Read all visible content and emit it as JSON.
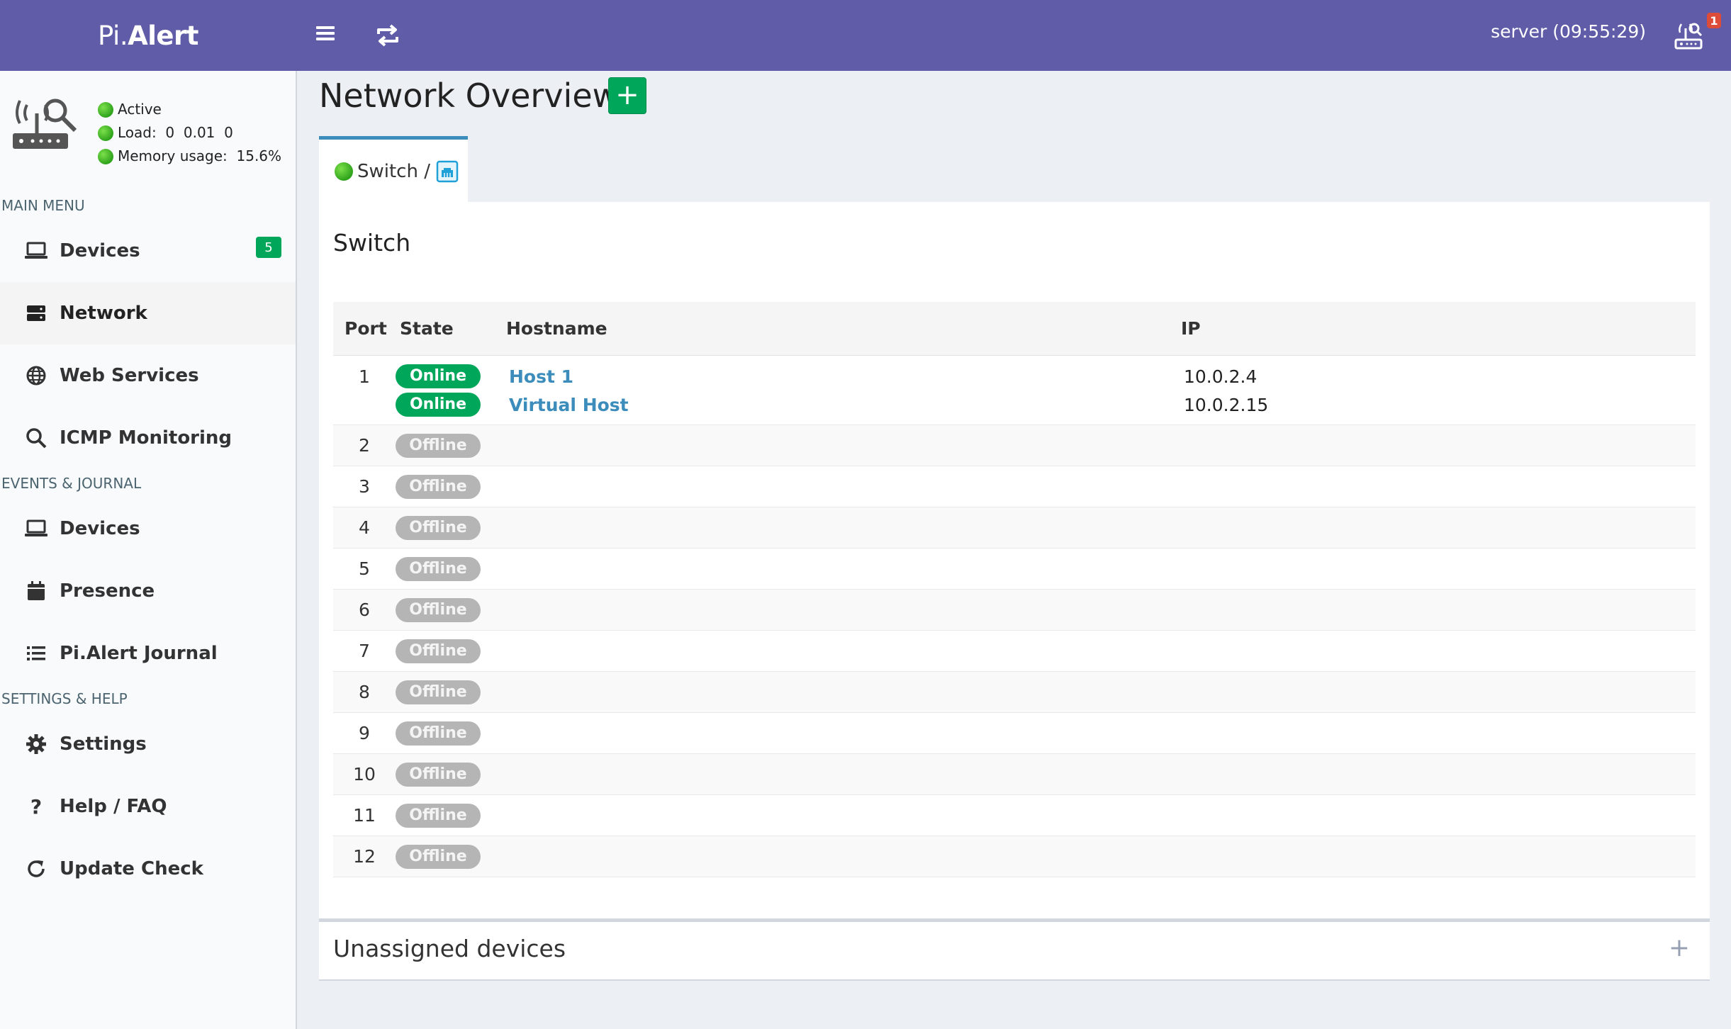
{
  "app": {
    "logo_pi": "Pi.",
    "logo_alert": "Alert",
    "server_time": "server (09:55:29)",
    "notification_count": "1"
  },
  "status": {
    "active": "Active",
    "load": "Load:  0  0.01  0",
    "memory": "Memory usage:  15.6%"
  },
  "sidebar": {
    "sections": {
      "main": "MAIN MENU",
      "events": "EVENTS & JOURNAL",
      "settings": "SETTINGS & HELP"
    },
    "main_items": [
      {
        "label": "Devices",
        "icon": "laptop-icon",
        "badge": "5"
      },
      {
        "label": "Network",
        "icon": "server-icon",
        "active": true
      },
      {
        "label": "Web Services",
        "icon": "globe-icon"
      },
      {
        "label": "ICMP Monitoring",
        "icon": "search-icon"
      }
    ],
    "event_items": [
      {
        "label": "Devices",
        "icon": "laptop-icon"
      },
      {
        "label": "Presence",
        "icon": "calendar-icon"
      },
      {
        "label": "Pi.Alert Journal",
        "icon": "list-icon"
      }
    ],
    "settings_items": [
      {
        "label": "Settings",
        "icon": "gear-icon"
      },
      {
        "label": "Help / FAQ",
        "icon": "question-icon"
      },
      {
        "label": "Update Check",
        "icon": "refresh-icon"
      }
    ]
  },
  "main": {
    "title": "Network Overview",
    "add_label": "+",
    "tab_label": "Switch /",
    "panel_title": "Switch",
    "table": {
      "headers": [
        "Port",
        "State",
        "Hostname",
        "IP"
      ],
      "rows": [
        {
          "port": "1",
          "entries": [
            {
              "state": "Online",
              "hostname": "Host 1",
              "ip": "10.0.2.4"
            },
            {
              "state": "Online",
              "hostname": "Virtual Host",
              "ip": "10.0.2.15"
            }
          ]
        },
        {
          "port": "2",
          "state": "Offline"
        },
        {
          "port": "3",
          "state": "Offline"
        },
        {
          "port": "4",
          "state": "Offline"
        },
        {
          "port": "5",
          "state": "Offline"
        },
        {
          "port": "6",
          "state": "Offline"
        },
        {
          "port": "7",
          "state": "Offline"
        },
        {
          "port": "8",
          "state": "Offline"
        },
        {
          "port": "9",
          "state": "Offline"
        },
        {
          "port": "10",
          "state": "Offline"
        },
        {
          "port": "11",
          "state": "Offline"
        },
        {
          "port": "12",
          "state": "Offline"
        }
      ]
    },
    "unassigned_title": "Unassigned devices",
    "expand_label": "+"
  },
  "colors": {
    "topbar": "#605ca8",
    "online": "#00a65a",
    "offline": "#b5b5b5",
    "link": "#3c8dbc"
  }
}
